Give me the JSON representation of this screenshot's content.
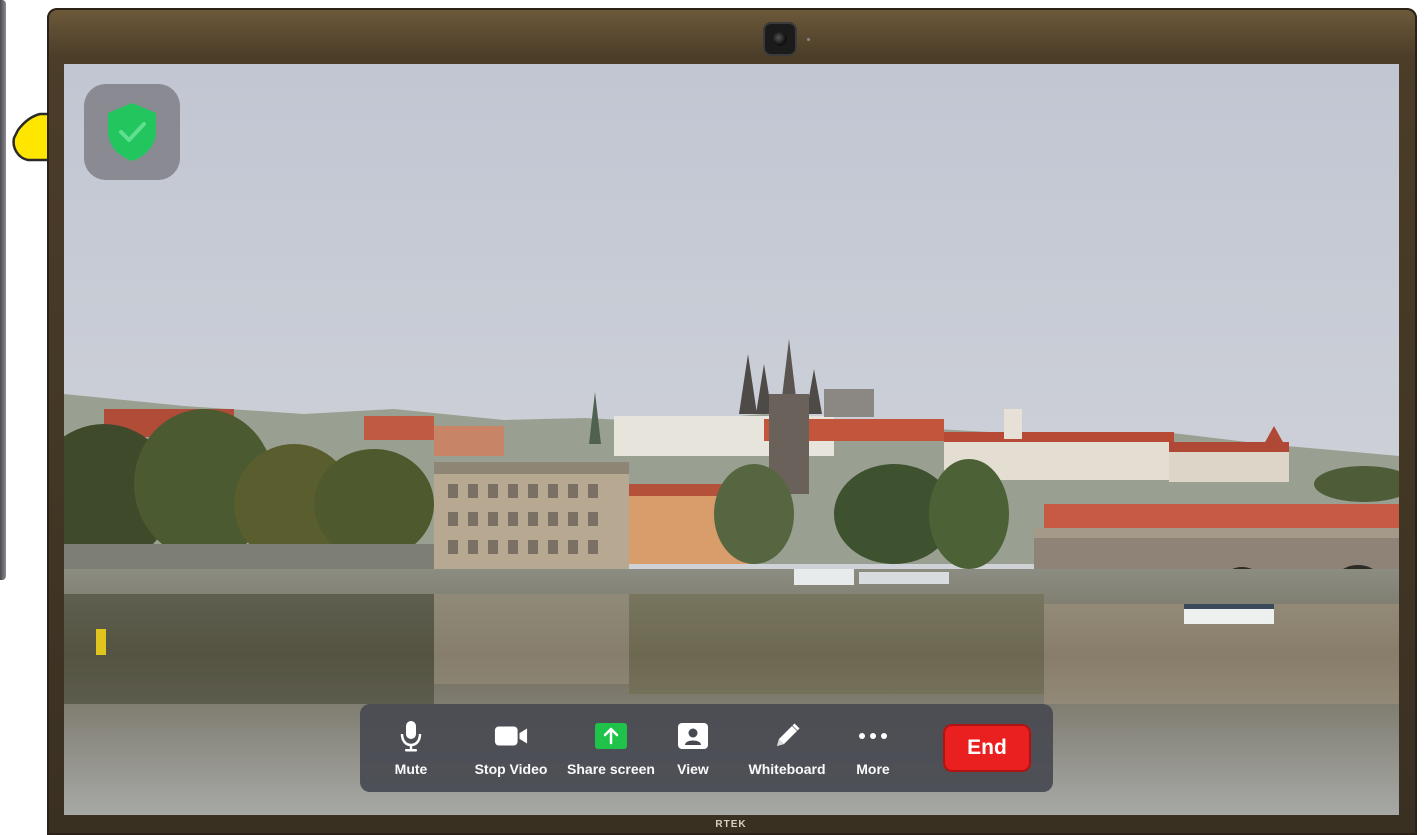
{
  "toolbar": {
    "buttons": [
      {
        "id": "mute",
        "label": "Mute",
        "icon": "microphone-icon"
      },
      {
        "id": "stop-video",
        "label": "Stop Video",
        "icon": "video-camera-icon"
      },
      {
        "id": "share-screen",
        "label": "Share screen",
        "icon": "share-screen-icon"
      },
      {
        "id": "view",
        "label": "View",
        "icon": "view-icon"
      },
      {
        "id": "whiteboard",
        "label": "Whiteboard",
        "icon": "pencil-icon"
      },
      {
        "id": "more",
        "label": "More",
        "icon": "more-dots-icon"
      }
    ],
    "end_label": "End"
  },
  "security": {
    "icon": "shield-check-icon",
    "color": "#22c55e"
  },
  "pointer": {
    "icon": "pointing-hand-icon",
    "color": "#ffe600"
  },
  "monitor": {
    "brand": "RTEK"
  },
  "colors": {
    "end_button": "#e9201f",
    "share_icon": "#1fc34a",
    "toolbar": "#484a52"
  }
}
